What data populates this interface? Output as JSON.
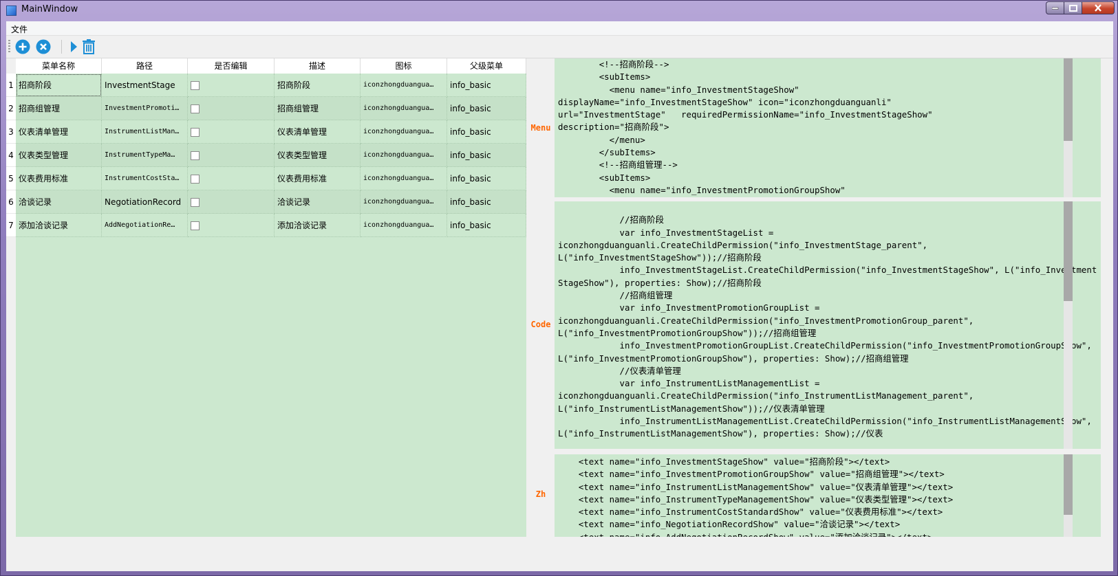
{
  "window": {
    "title": "MainWindow"
  },
  "menu": {
    "file": "文件"
  },
  "toolbar": {
    "buttons": [
      {
        "name": "add",
        "icon": "plus-circle-icon"
      },
      {
        "name": "remove",
        "icon": "x-circle-icon"
      },
      {
        "name": "run",
        "icon": "play-icon"
      },
      {
        "name": "delete",
        "icon": "trash-icon"
      }
    ],
    "accent": "#1e8fd6"
  },
  "table": {
    "headers": [
      "菜单名称",
      "路径",
      "是否编辑",
      "描述",
      "图标",
      "父级菜单"
    ],
    "row_numbers": [
      "1",
      "2",
      "3",
      "4",
      "5",
      "6",
      "7"
    ],
    "rows": [
      {
        "name": "招商阶段",
        "path": "InvestmentStage",
        "editable": false,
        "desc": "招商阶段",
        "icon": "iconzhongduangua…",
        "parent": "info_basic"
      },
      {
        "name": "招商组管理",
        "path": "InvestmentPromoti…",
        "editable": false,
        "desc": "招商组管理",
        "icon": "iconzhongduangua…",
        "parent": "info_basic"
      },
      {
        "name": "仪表清单管理",
        "path": "InstrumentListMan…",
        "editable": false,
        "desc": "仪表清单管理",
        "icon": "iconzhongduangua…",
        "parent": "info_basic"
      },
      {
        "name": "仪表类型管理",
        "path": "InstrumentTypeMa…",
        "editable": false,
        "desc": "仪表类型管理",
        "icon": "iconzhongduangua…",
        "parent": "info_basic"
      },
      {
        "name": "仪表费用标准",
        "path": "InstrumentCostSta…",
        "editable": false,
        "desc": "仪表费用标准",
        "icon": "iconzhongduangua…",
        "parent": "info_basic"
      },
      {
        "name": "洽谈记录",
        "path": "NegotiationRecord",
        "editable": false,
        "desc": "洽谈记录",
        "icon": "iconzhongduangua…",
        "parent": "info_basic"
      },
      {
        "name": "添加洽谈记录",
        "path": "AddNegotiationRe…",
        "editable": false,
        "desc": "添加洽谈记录",
        "icon": "iconzhongduangua…",
        "parent": "info_basic"
      }
    ]
  },
  "panels": {
    "menu_label": "Menu",
    "code_label": "Code",
    "zh_label": "Zh",
    "menu_text": "        <!--招商阶段-->\n        <subItems>\n          <menu name=\"info_InvestmentStageShow\"\ndisplayName=\"info_InvestmentStageShow\" icon=\"iconzhongduanguanli\"\nurl=\"InvestmentStage\"   requiredPermissionName=\"info_InvestmentStageShow\"\ndescription=\"招商阶段\">\n          </menu>\n        </subItems>\n        <!--招商组管理-->\n        <subItems>\n          <menu name=\"info_InvestmentPromotionGroupShow\"",
    "code_text": "\n            //招商阶段\n            var info_InvestmentStageList = \niconzhongduanguanli.CreateChildPermission(\"info_InvestmentStage_parent\", \nL(\"info_InvestmentStageShow\"));//招商阶段\n            info_InvestmentStageList.CreateChildPermission(\"info_InvestmentStageShow\", L(\"info_InvestmentStageShow\"), properties: Show);//招商阶段\n            //招商组管理\n            var info_InvestmentPromotionGroupList = \niconzhongduanguanli.CreateChildPermission(\"info_InvestmentPromotionGroup_parent\", \nL(\"info_InvestmentPromotionGroupShow\"));//招商组管理\n            info_InvestmentPromotionGroupList.CreateChildPermission(\"info_InvestmentPromotionGroupShow\", L(\"info_InvestmentPromotionGroupShow\"), properties: Show);//招商组管理\n            //仪表清单管理\n            var info_InstrumentListManagementList = \niconzhongduanguanli.CreateChildPermission(\"info_InstrumentListManagement_parent\", \nL(\"info_InstrumentListManagementShow\"));//仪表清单管理\n            info_InstrumentListManagementList.CreateChildPermission(\"info_InstrumentListManagementShow\", L(\"info_InstrumentListManagementShow\"), properties: Show);//仪表",
    "zh_text": "    <text name=\"info_InvestmentStageShow\" value=\"招商阶段\"></text>\n    <text name=\"info_InvestmentPromotionGroupShow\" value=\"招商组管理\"></text>\n    <text name=\"info_InstrumentListManagementShow\" value=\"仪表清单管理\"></text>\n    <text name=\"info_InstrumentTypeManagementShow\" value=\"仪表类型管理\"></text>\n    <text name=\"info_InstrumentCostStandardShow\" value=\"仪表费用标准\"></text>\n    <text name=\"info_NegotiationRecordShow\" value=\"洽谈记录\"></text>\n    <text name=\"info_AddNegotiationRecordShow\" value=\"添加洽谈记录\"></text>"
  },
  "colors": {
    "row_bg": "#cce8cf",
    "label": "#ff6600"
  }
}
